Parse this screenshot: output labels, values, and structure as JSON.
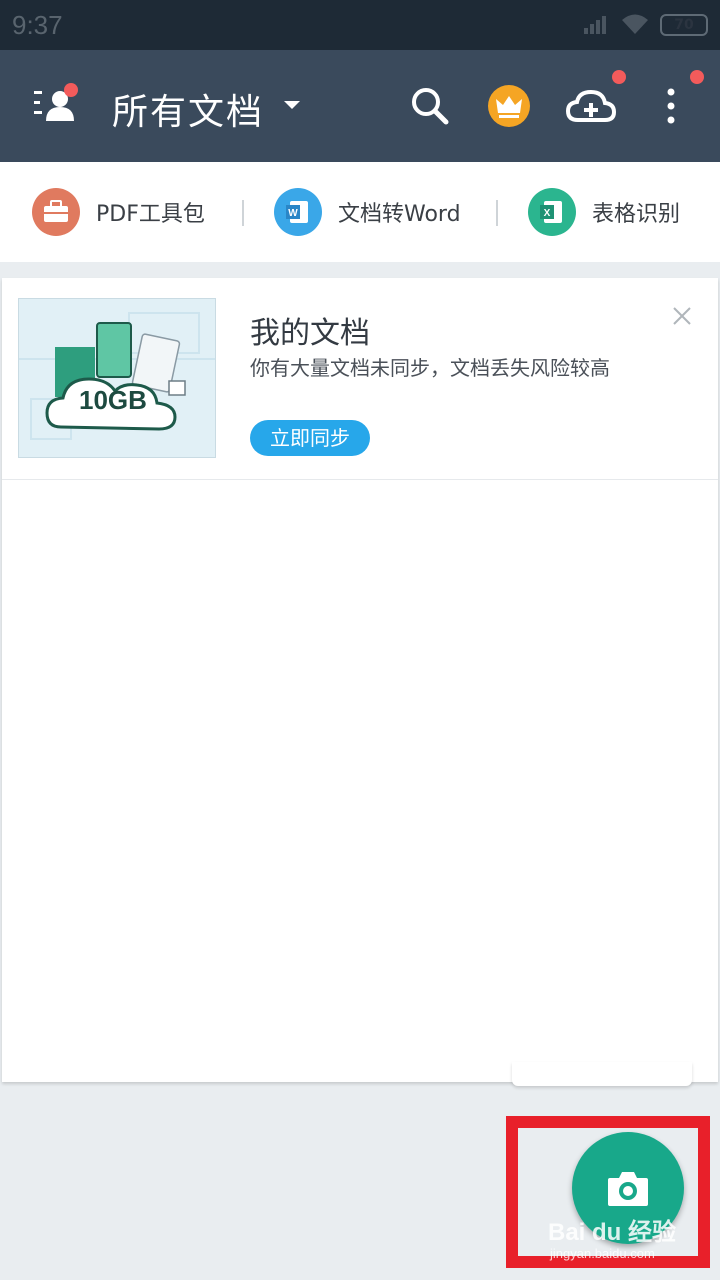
{
  "status_bar": {
    "time": "9:37",
    "battery": "70"
  },
  "app_bar": {
    "title": "所有文档",
    "icons": [
      "user-menu-icon",
      "search-icon",
      "vip-crown-icon",
      "cloud-upload-icon",
      "more-vert-icon"
    ]
  },
  "tools": [
    {
      "label": "PDF工具包",
      "icon": "toolbox-icon",
      "color": "#e07a5f"
    },
    {
      "label": "文档转Word",
      "icon": "word-icon",
      "color": "#3aa7e8"
    },
    {
      "label": "表格识别",
      "icon": "excel-icon",
      "color": "#2bb58f"
    }
  ],
  "banner": {
    "image_text": "10GB",
    "title": "我的文档",
    "description": "你有大量文档未同步，文档丢失风险较高",
    "button_label": "立即同步"
  },
  "fab": {
    "icon": "camera-icon",
    "color": "#18a88a"
  },
  "watermark": {
    "brand": "Bai du 经验",
    "url": "jingyan.baidu.com"
  },
  "colors": {
    "app_bar": "#3a4a5c",
    "status_bar": "#1e2a36",
    "highlight": "#e8202a",
    "notification_dot": "#f35b5b",
    "sync_button": "#27a7ea"
  }
}
